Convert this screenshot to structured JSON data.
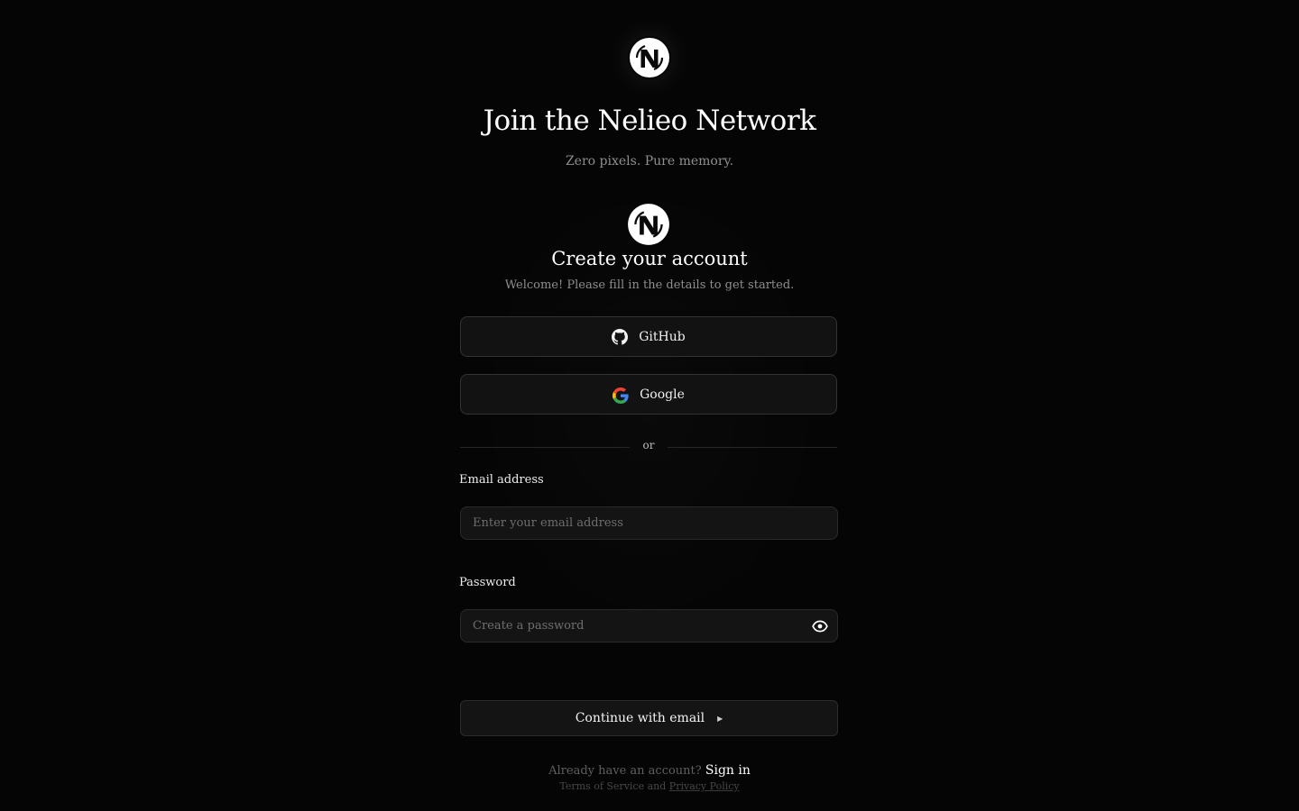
{
  "hero": {
    "logo_icon": "nelieo-logo-icon",
    "title": "Join the Nelieo Network",
    "subtitle": "Zero pixels. Pure memory."
  },
  "card": {
    "logo_icon": "nelieo-logo-icon",
    "title": "Create your account",
    "subtitle": "Welcome! Please fill in the details to get started."
  },
  "social": {
    "github": {
      "label": "GitHub",
      "icon": "github-icon"
    },
    "google": {
      "label": "Google",
      "icon": "google-icon"
    }
  },
  "divider": {
    "text": "or"
  },
  "form": {
    "email": {
      "label": "Email address",
      "placeholder": "Enter your email address",
      "value": ""
    },
    "password": {
      "label": "Password",
      "placeholder": "Create a password",
      "value": "",
      "toggle_icon": "eye-icon"
    },
    "submit": {
      "label": "Continue with email",
      "icon": "caret-right-icon"
    }
  },
  "footer": {
    "prompt": "Already have an account?",
    "link": "Sign in",
    "terms": "Terms of Service",
    "and": "and",
    "privacy": "Privacy Policy"
  },
  "colors": {
    "background": "#050505",
    "surface": "#121212",
    "border": "#333333",
    "text": "#f2f2f2",
    "muted": "#8f8f8f"
  }
}
